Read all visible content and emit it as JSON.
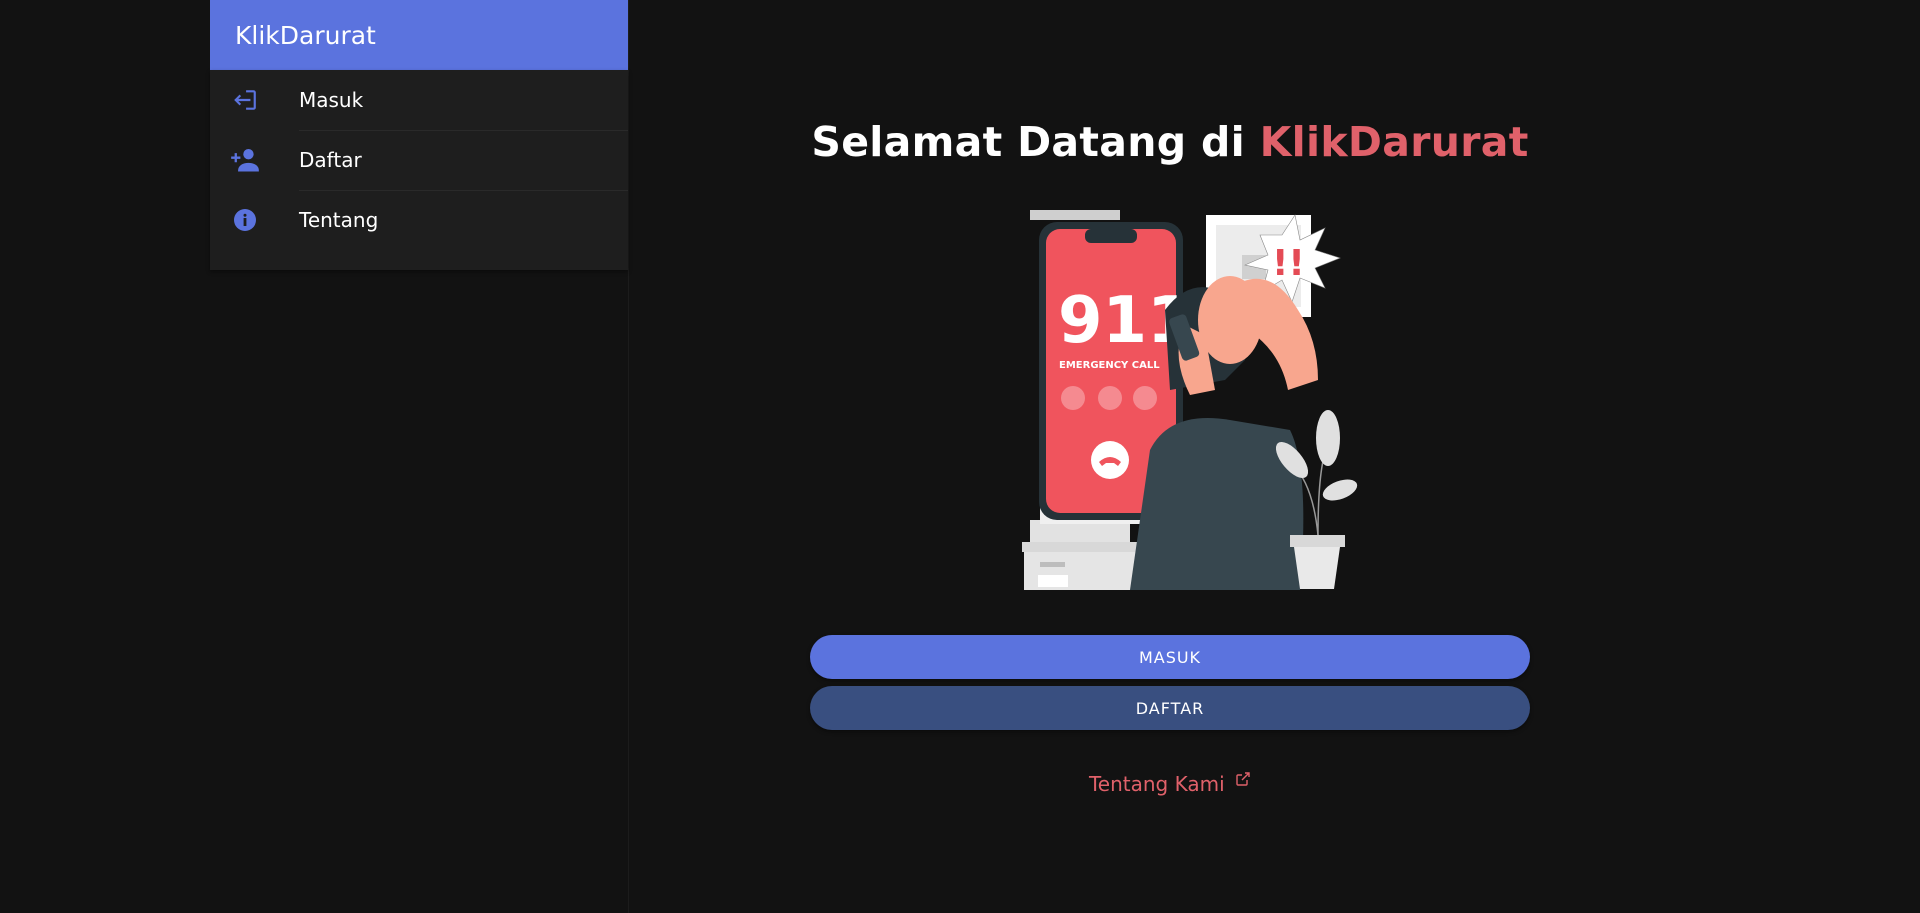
{
  "sidebar": {
    "title": "KlikDarurat",
    "items": [
      {
        "label": "Masuk",
        "icon": "login-icon"
      },
      {
        "label": "Daftar",
        "icon": "person-add-icon"
      },
      {
        "label": "Tentang",
        "icon": "info-icon"
      }
    ]
  },
  "main": {
    "welcome_prefix": "Selamat Datang di",
    "welcome_brand": "KlikDarurat",
    "phone_number": "911",
    "phone_caption": "EMERGENCY CALL",
    "masuk_button": "MASUK",
    "daftar_button": "DAFTAR",
    "about_link": "Tentang Kami"
  },
  "colors": {
    "accent": "#5b73de",
    "secondary": "#394f80",
    "brand_red": "#e0616a",
    "background": "#121212"
  }
}
